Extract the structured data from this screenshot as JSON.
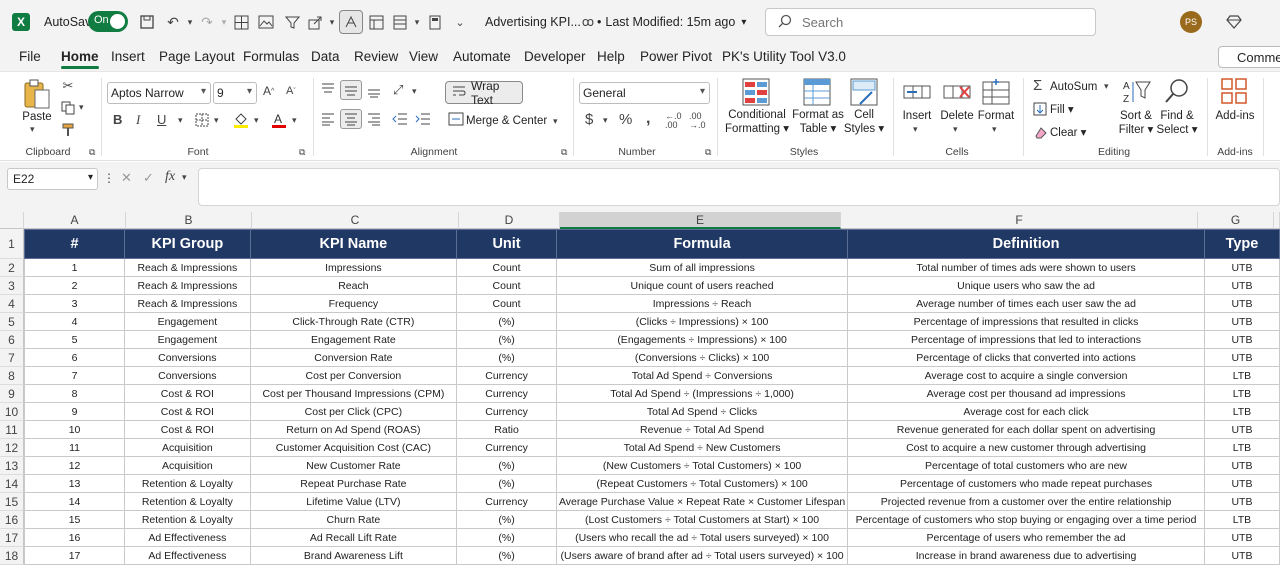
{
  "titlebar": {
    "autosave_label": "AutoSave",
    "autosave_state": "On",
    "doc_title": "Advertising KPI...",
    "modified": "Last Modified: 15m ago",
    "search_placeholder": "Search",
    "user_initials": "PS"
  },
  "menu": {
    "tabs": [
      "File",
      "Home",
      "Insert",
      "Page Layout",
      "Formulas",
      "Data",
      "Review",
      "View",
      "Automate",
      "Developer",
      "Help",
      "Power Pivot",
      "PK's Utility Tool V3.0"
    ],
    "active": "Home",
    "comments": "Comme"
  },
  "ribbon": {
    "clipboard": {
      "paste": "Paste",
      "group": "Clipboard"
    },
    "font": {
      "name": "Aptos Narrow",
      "size": "9",
      "group": "Font"
    },
    "alignment": {
      "wrap": "Wrap Text",
      "merge": "Merge & Center",
      "group": "Alignment"
    },
    "number": {
      "format": "General",
      "group": "Number"
    },
    "styles": {
      "conditional": [
        "Conditional",
        "Formatting"
      ],
      "format_table": [
        "Format as",
        "Table"
      ],
      "cell_styles": [
        "Cell",
        "Styles"
      ],
      "group": "Styles"
    },
    "cells": {
      "insert": "Insert",
      "delete": "Delete",
      "format": "Format",
      "group": "Cells"
    },
    "editing": {
      "autosum": "AutoSum",
      "fill": "Fill",
      "clear": "Clear",
      "sort": [
        "Sort &",
        "Filter"
      ],
      "find": [
        "Find &",
        "Select"
      ],
      "group": "Editing"
    },
    "addins": {
      "label": "Add-ins",
      "group": "Add-ins"
    }
  },
  "formulabar": {
    "namebox": "E22",
    "fx": "fx",
    "content": ""
  },
  "sheet": {
    "columns": [
      "A",
      "B",
      "C",
      "D",
      "E",
      "F",
      "G"
    ],
    "selected_column": "E",
    "row_numbers": [
      "1",
      "2",
      "3",
      "4",
      "5",
      "6",
      "7",
      "8",
      "9",
      "10",
      "11",
      "12",
      "13",
      "14",
      "15",
      "16",
      "17",
      "18"
    ],
    "headers": [
      "#",
      "KPI Group",
      "KPI Name",
      "Unit",
      "Formula",
      "Definition",
      "Type"
    ],
    "rows": [
      [
        "1",
        "Reach & Impressions",
        "Impressions",
        "Count",
        "Sum of all impressions",
        "Total number of times ads were shown to users",
        "UTB"
      ],
      [
        "2",
        "Reach & Impressions",
        "Reach",
        "Count",
        "Unique count of users reached",
        "Unique users who saw the ad",
        "UTB"
      ],
      [
        "3",
        "Reach & Impressions",
        "Frequency",
        "Count",
        "Impressions ÷ Reach",
        "Average number of times each user saw the ad",
        "UTB"
      ],
      [
        "4",
        "Engagement",
        "Click-Through Rate (CTR)",
        "(%)",
        "(Clicks ÷ Impressions) × 100",
        "Percentage of impressions that resulted in clicks",
        "UTB"
      ],
      [
        "5",
        "Engagement",
        "Engagement Rate",
        "(%)",
        "(Engagements ÷ Impressions) × 100",
        "Percentage of impressions that led to interactions",
        "UTB"
      ],
      [
        "6",
        "Conversions",
        "Conversion Rate",
        "(%)",
        "(Conversions ÷ Clicks) × 100",
        "Percentage of clicks that converted into actions",
        "UTB"
      ],
      [
        "7",
        "Conversions",
        "Cost per Conversion",
        "Currency",
        "Total Ad Spend ÷ Conversions",
        "Average cost to acquire a single conversion",
        "LTB"
      ],
      [
        "8",
        "Cost & ROI",
        "Cost per Thousand Impressions (CPM)",
        "Currency",
        "Total Ad Spend ÷ (Impressions ÷ 1,000)",
        "Average cost per thousand ad impressions",
        "LTB"
      ],
      [
        "9",
        "Cost & ROI",
        "Cost per Click (CPC)",
        "Currency",
        "Total Ad Spend ÷ Clicks",
        "Average cost for each click",
        "LTB"
      ],
      [
        "10",
        "Cost & ROI",
        "Return on Ad Spend (ROAS)",
        "Ratio",
        "Revenue ÷ Total Ad Spend",
        "Revenue generated for each dollar spent on advertising",
        "UTB"
      ],
      [
        "11",
        "Acquisition",
        "Customer Acquisition Cost (CAC)",
        "Currency",
        "Total Ad Spend ÷ New Customers",
        "Cost to acquire a new customer through advertising",
        "LTB"
      ],
      [
        "12",
        "Acquisition",
        "New Customer Rate",
        "(%)",
        "(New Customers ÷ Total Customers) × 100",
        "Percentage of total customers who are new",
        "UTB"
      ],
      [
        "13",
        "Retention & Loyalty",
        "Repeat Purchase Rate",
        "(%)",
        "(Repeat Customers ÷ Total Customers) × 100",
        "Percentage of customers who made repeat purchases",
        "UTB"
      ],
      [
        "14",
        "Retention & Loyalty",
        "Lifetime Value (LTV)",
        "Currency",
        "Average Purchase Value × Repeat Rate × Customer Lifespan",
        "Projected revenue from a customer over the entire relationship",
        "UTB"
      ],
      [
        "15",
        "Retention & Loyalty",
        "Churn Rate",
        "(%)",
        "(Lost Customers ÷ Total Customers at Start) × 100",
        "Percentage of customers who stop buying or engaging over a time period",
        "LTB"
      ],
      [
        "16",
        "Ad Effectiveness",
        "Ad Recall Lift Rate",
        "(%)",
        "(Users who recall the ad ÷ Total users surveyed) × 100",
        "Percentage of users who remember the ad",
        "UTB"
      ],
      [
        "17",
        "Ad Effectiveness",
        "Brand Awareness Lift",
        "(%)",
        "(Users aware of brand after ad ÷ Total users surveyed) × 100",
        "Increase in brand awareness due to advertising",
        "UTB"
      ]
    ]
  }
}
